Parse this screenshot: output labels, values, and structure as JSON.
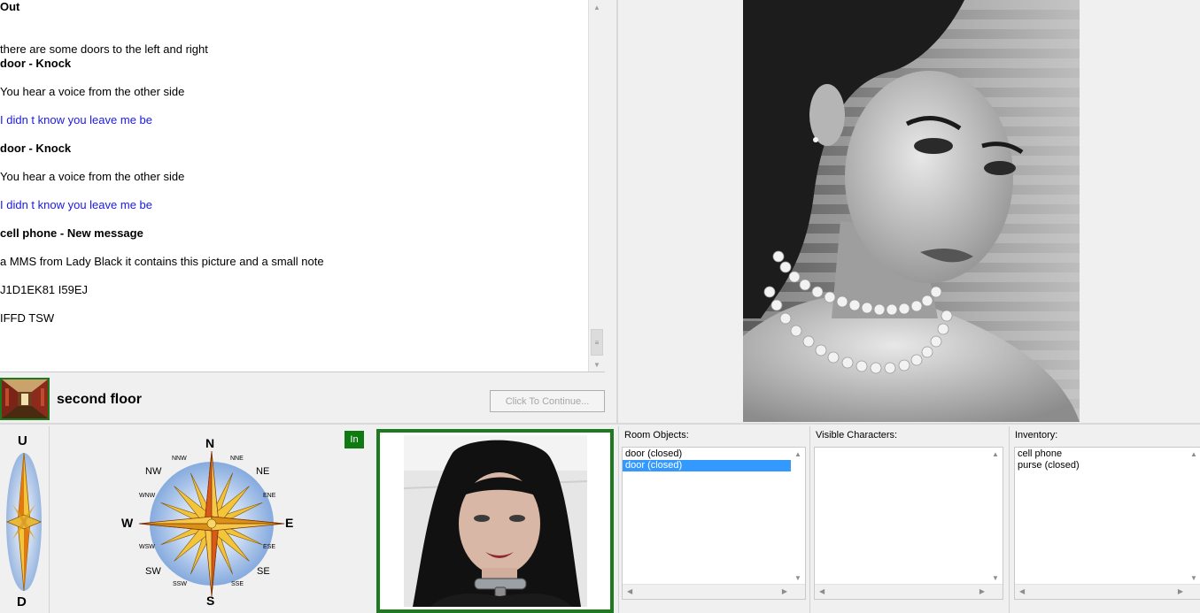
{
  "log": {
    "lines": [
      {
        "text": "Out",
        "style": "heading"
      },
      {
        "text": "there are some doors to the left and right",
        "style": "normal"
      },
      {
        "text": "door - Knock",
        "style": "heading"
      },
      {
        "text": "You hear a voice from the other side",
        "style": "normal"
      },
      {
        "text": "I didn t know you leave me be",
        "style": "blue"
      },
      {
        "text": "door - Knock",
        "style": "heading"
      },
      {
        "text": "You hear a voice from the other side",
        "style": "normal"
      },
      {
        "text": "I didn t know you leave me be",
        "style": "blue"
      },
      {
        "text": "cell phone - New message",
        "style": "heading"
      },
      {
        "text": "a MMS from Lady Black it contains this picture and a small note",
        "style": "normal"
      },
      {
        "text": "J1D1EK81 I59EJ",
        "style": "normal"
      },
      {
        "text": "IFFD TSW",
        "style": "normal"
      }
    ]
  },
  "location": {
    "name": "second floor",
    "continue_label": "Click To Continue..."
  },
  "navigation": {
    "up": "U",
    "down": "D",
    "in_label": "In",
    "compass": {
      "n": "N",
      "s": "S",
      "e": "E",
      "w": "W",
      "ne": "NE",
      "nw": "NW",
      "se": "SE",
      "sw": "SW",
      "nne": "NNE",
      "nnw": "NNW",
      "ene": "ENE",
      "wnw": "WNW",
      "ese": "ESE",
      "wsw": "WSW",
      "sse": "SSE",
      "ssw": "SSW"
    }
  },
  "panels": {
    "room_objects": {
      "title": "Room Objects:",
      "items": [
        {
          "label": "door (closed)",
          "selected": false
        },
        {
          "label": "door (closed)",
          "selected": true
        }
      ]
    },
    "visible_characters": {
      "title": "Visible Characters:",
      "items": []
    },
    "inventory": {
      "title": "Inventory:",
      "items": [
        {
          "label": "cell phone",
          "selected": false
        },
        {
          "label": "purse (closed)",
          "selected": false
        }
      ]
    }
  },
  "colors": {
    "accent_green": "#1f7a1f",
    "selection_blue": "#3399ff",
    "dialog_blue": "#1a1ae6",
    "compass_gold": "#e8b21c"
  },
  "icons": {
    "location_thumbnail": "hallway-image",
    "portrait": "woman-portrait-image",
    "character": "character-portrait-image",
    "compass": "compass-rose-icon",
    "updown": "updown-arrow-icon"
  }
}
